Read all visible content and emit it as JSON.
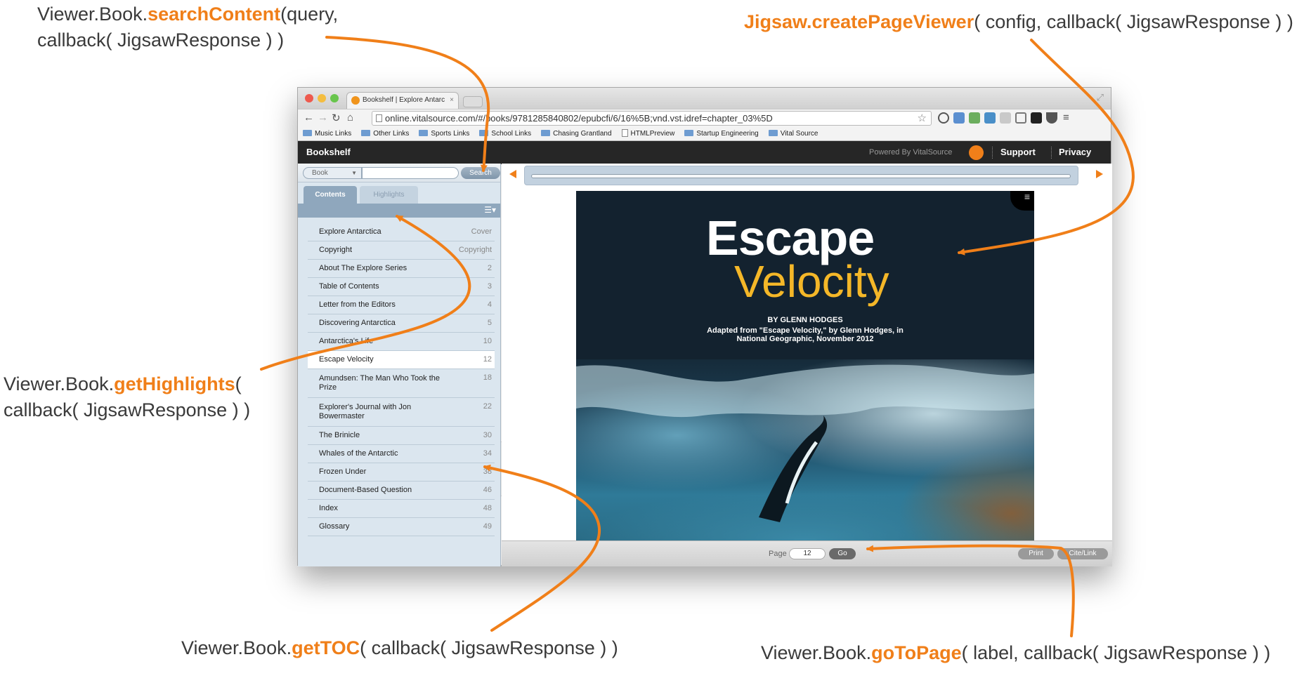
{
  "annotations": {
    "search": {
      "prefix": "Viewer.Book.",
      "method": "searchContent",
      "suffix": "(query,",
      "line2": "callback( JigsawResponse ) )"
    },
    "create": {
      "method": "Jigsaw.createPageViewer",
      "suffix": "( config, callback( JigsawResponse ) )"
    },
    "highlights": {
      "prefix": "Viewer.Book.",
      "method": "getHighlights",
      "suffix": "(",
      "line2": "callback( JigsawResponse ) )"
    },
    "toc": {
      "prefix": "Viewer.Book.",
      "method": "getTOC",
      "suffix": "( callback( JigsawResponse ) )"
    },
    "goto": {
      "prefix": "Viewer.Book.",
      "method": "goToPage",
      "suffix": "( label, callback( JigsawResponse ) )"
    }
  },
  "colors": {
    "accent": "#f07f19",
    "title_yellow": "#f4b728",
    "book_bg": "#13222f"
  },
  "browser": {
    "tab_title": "Bookshelf | Explore Antarc",
    "url": "online.vitalsource.com/#/books/9781285840802/epubcfi/6/16%5B;vnd.vst.idref=chapter_03%5D",
    "bookmarks": [
      "Music Links",
      "Other Links",
      "Sports Links",
      "School Links",
      "Chasing Grantland",
      "HTMLPreview",
      "Startup Engineering",
      "Vital Source"
    ]
  },
  "app": {
    "brand": "Bookshelf",
    "powered": "Powered By VitalSource",
    "support": "Support",
    "privacy": "Privacy"
  },
  "sidebar": {
    "scope": "Book",
    "search_button": "Search",
    "tabs": {
      "contents": "Contents",
      "highlights": "Highlights"
    },
    "toc": [
      {
        "title": "Explore Antarctica",
        "page": "Cover"
      },
      {
        "title": "Copyright",
        "page": "Copyright"
      },
      {
        "title": "About The Explore Series",
        "page": "2"
      },
      {
        "title": "Table of Contents",
        "page": "3"
      },
      {
        "title": "Letter from the Editors",
        "page": "4"
      },
      {
        "title": "Discovering Antarctica",
        "page": "5"
      },
      {
        "title": "Antarctica's Life",
        "page": "10"
      },
      {
        "title": "Escape Velocity",
        "page": "12"
      },
      {
        "title": "Amundsen: The Man Who Took the Prize",
        "page": "18"
      },
      {
        "title": "Explorer's Journal with Jon Bowermaster",
        "page": "22"
      },
      {
        "title": "The Brinicle",
        "page": "30"
      },
      {
        "title": "Whales of the Antarctic",
        "page": "34"
      },
      {
        "title": "Frozen Under",
        "page": "38"
      },
      {
        "title": "Document-Based Question",
        "page": "46"
      },
      {
        "title": "Index",
        "page": "48"
      },
      {
        "title": "Glossary",
        "page": "49"
      }
    ]
  },
  "page": {
    "title1": "Escape",
    "title2": "Velocity",
    "byline": "BY GLENN HODGES",
    "adapted1": "Adapted from \"Escape Velocity,\" by Glenn Hodges, in",
    "adapted2": "National Geographic, November 2012"
  },
  "footer": {
    "page_label": "Page",
    "page_value": "12",
    "go": "Go",
    "print": "Print",
    "cite": "Cite/Link"
  }
}
